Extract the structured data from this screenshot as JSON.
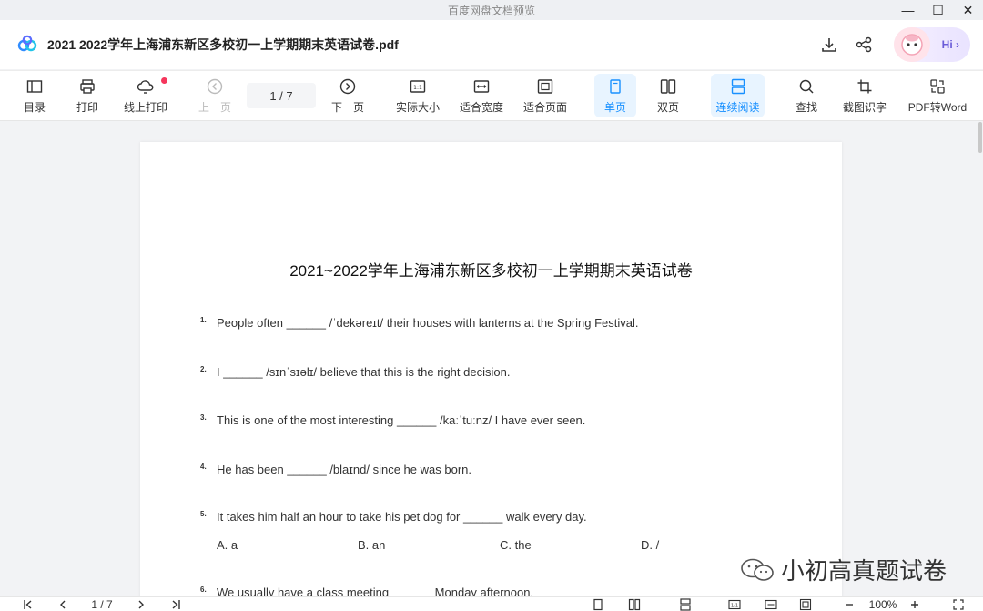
{
  "window": {
    "title": "百度网盘文档预览",
    "controls": [
      "minimize",
      "maximize",
      "close"
    ]
  },
  "header": {
    "doc_title": "2021  2022学年上海浦东新区多校初一上学期期末英语试卷.pdf",
    "download_icon": "download-icon",
    "share_icon": "share-icon",
    "assistant_label": "Hi"
  },
  "toolbar": {
    "toc": "目录",
    "print": "打印",
    "online_print": "线上打印",
    "prev_page": "上一页",
    "page_indicator": "1 / 7",
    "next_page": "下一页",
    "actual_size": "实际大小",
    "fit_width": "适合宽度",
    "fit_page": "适合页面",
    "single_page": "单页",
    "double_page": "双页",
    "continuous": "连续阅读",
    "find": "查找",
    "ocr": "截图识字",
    "pdf_to_word": "PDF转Word",
    "accent_color": "#1890ff"
  },
  "document": {
    "title": "2021~2022学年上海浦东新区多校初一上学期期末英语试卷",
    "questions": [
      {
        "num": "1.",
        "text": "People often ______ /ˈdekəreɪt/ their houses with lanterns at the Spring Festival."
      },
      {
        "num": "2.",
        "text": "I ______ /sɪnˈsɪəlɪ/ believe that this is the right decision."
      },
      {
        "num": "3.",
        "text": "This is one of the most interesting ______ /kaːˈtuːnz/ I have ever seen."
      },
      {
        "num": "4.",
        "text": "He has been ______ /blaɪnd/ since he was born."
      },
      {
        "num": "5.",
        "text": "It takes him half an hour to take his pet dog for ______ walk every day."
      },
      {
        "num": "6.",
        "text": "We usually have a class meeting ______ Monday afternoon."
      }
    ],
    "q5_options": [
      "A. a",
      "B. an",
      "C. the",
      "D. /"
    ],
    "watermark": "小初高真题试卷"
  },
  "bottombar": {
    "page_indicator": "1 / 7",
    "zoom": "100%"
  }
}
